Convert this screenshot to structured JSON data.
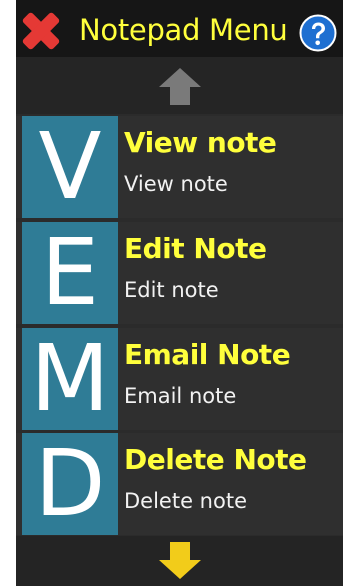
{
  "header": {
    "title": "Notepad Menu",
    "close_icon": "close-icon",
    "help_icon": "help-icon",
    "colors": {
      "title": "#ffff3c",
      "close": "#e53935",
      "help": "#1e6fd1"
    }
  },
  "scroll": {
    "up_icon": "arrow-up-icon",
    "down_icon": "arrow-down-icon",
    "colors": {
      "up_disabled": "#7a7a7a",
      "down_active": "#f2cc1a"
    }
  },
  "menu": {
    "items": [
      {
        "letter": "V",
        "title": "View note",
        "subtitle": "View note"
      },
      {
        "letter": "E",
        "title": "Edit Note",
        "subtitle": "Edit note"
      },
      {
        "letter": "M",
        "title": "Email Note",
        "subtitle": "Email note"
      },
      {
        "letter": "D",
        "title": "Delete Note",
        "subtitle": "Delete note"
      }
    ],
    "colors": {
      "tile": "#2f7c96",
      "title": "#ffff3c",
      "subtitle": "#f2f2f2"
    }
  }
}
